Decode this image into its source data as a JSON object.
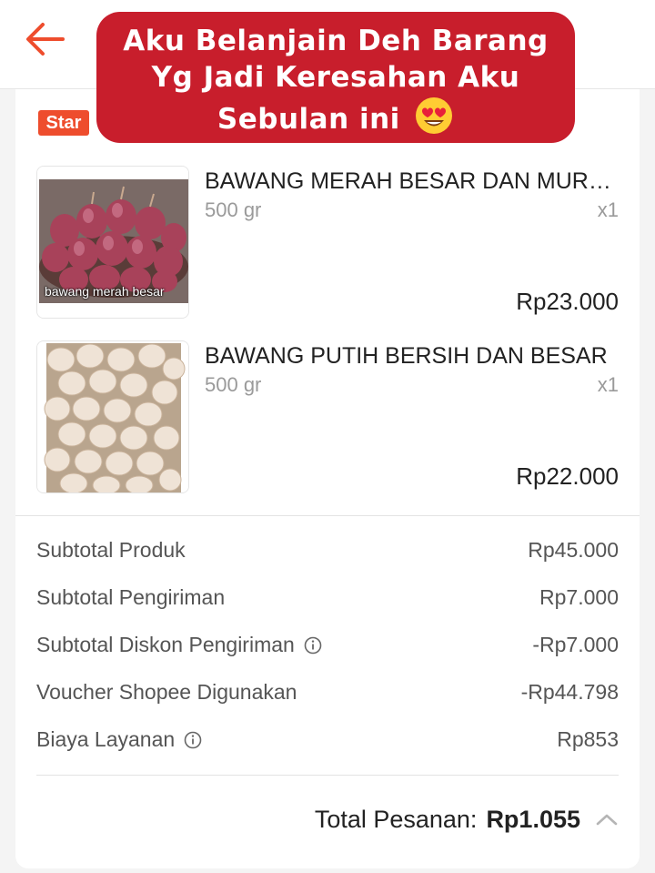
{
  "header": {
    "back_icon": "arrow-left-icon",
    "accent_color": "#ee4d2d"
  },
  "overlay_caption": {
    "line1": "Aku Belanjain Deh Barang",
    "line2": "Yg Jadi Keresahan Aku",
    "line3": "Sebulan ini",
    "emoji": "heart-eyes-emoji",
    "background": "#c81e2c"
  },
  "shop": {
    "badge": "Star"
  },
  "products": [
    {
      "name": "BAWANG MERAH BESAR  DAN MURAH",
      "variant": "500 gr",
      "qty": "x1",
      "price": "Rp23.000",
      "image_caption": "bawang merah besar"
    },
    {
      "name": "BAWANG PUTIH BERSIH  DAN BESAR",
      "variant": "500 gr",
      "qty": "x1",
      "price": "Rp22.000"
    }
  ],
  "summary": {
    "rows": [
      {
        "label": "Subtotal Produk",
        "value": "Rp45.000"
      },
      {
        "label": "Subtotal Pengiriman",
        "value": "Rp7.000"
      },
      {
        "label": "Subtotal Diskon Pengiriman",
        "value": "-Rp7.000",
        "info": true
      },
      {
        "label": "Voucher Shopee Digunakan",
        "value": "-Rp44.798"
      },
      {
        "label": "Biaya Layanan",
        "value": "Rp853",
        "info": true
      }
    ],
    "total_label": "Total Pesanan:",
    "total_value": "Rp1.055"
  }
}
